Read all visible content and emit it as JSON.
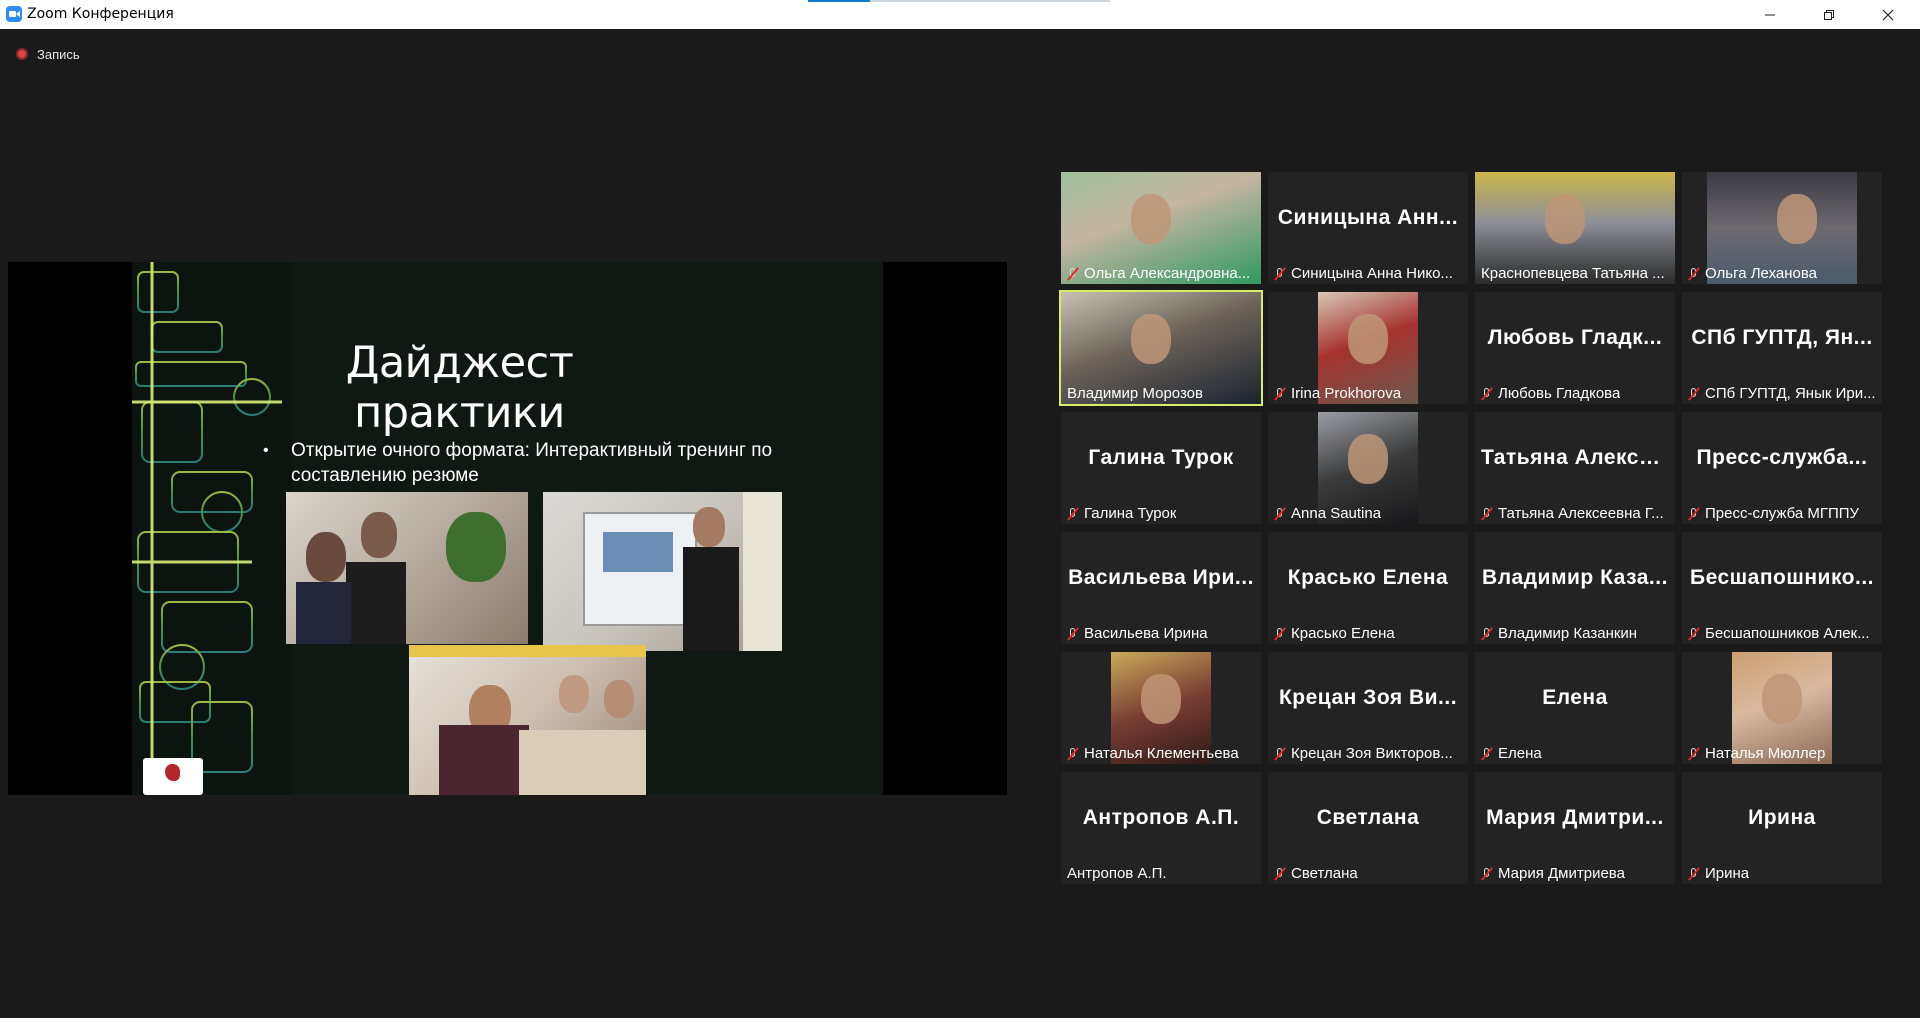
{
  "window": {
    "title": "Zoom Конференция"
  },
  "recording": {
    "label": "Запись"
  },
  "slide": {
    "title": "Дайджест практики",
    "bullet": "Открытие очного формата: Интерактивный тренинг по составлению резюме"
  },
  "participants": [
    {
      "name": "Ольга Александровна...",
      "display": "",
      "has_video": true,
      "muted": true
    },
    {
      "name": "Синицына Анна Нико...",
      "display": "Синицына Анн...",
      "has_video": false,
      "muted": true
    },
    {
      "name": "Краснопевцева Татьяна ...",
      "display": "",
      "has_video": true,
      "muted": false
    },
    {
      "name": "Ольга Леханова",
      "display": "",
      "has_video": true,
      "muted": true
    },
    {
      "name": "Владимир Морозов",
      "display": "",
      "has_video": true,
      "muted": false,
      "active_speaker": true
    },
    {
      "name": "Irina Prokhorova",
      "display": "",
      "has_video": true,
      "muted": true
    },
    {
      "name": "Любовь Гладкова",
      "display": "Любовь Гладк...",
      "has_video": false,
      "muted": true
    },
    {
      "name": "СПб ГУПТД, Янык Ири...",
      "display": "СПб ГУПТД, Ян...",
      "has_video": false,
      "muted": true
    },
    {
      "name": "Галина Турок",
      "display": "Галина Турок",
      "has_video": false,
      "muted": true
    },
    {
      "name": "Anna Sautina",
      "display": "",
      "has_video": true,
      "muted": true
    },
    {
      "name": "Татьяна Алексеевна Г...",
      "display": "Татьяна Алексе...",
      "has_video": false,
      "muted": true
    },
    {
      "name": "Пресс-служба МГППУ",
      "display": "Пресс-служба...",
      "has_video": false,
      "muted": true
    },
    {
      "name": "Васильева Ирина",
      "display": "Васильева Ири...",
      "has_video": false,
      "muted": true
    },
    {
      "name": "Красько Елена",
      "display": "Красько Елена",
      "has_video": false,
      "muted": true
    },
    {
      "name": "Владимир Казанкин",
      "display": "Владимир Каза...",
      "has_video": false,
      "muted": true
    },
    {
      "name": "Бесшапошников Алек...",
      "display": "Бесшапошнико...",
      "has_video": false,
      "muted": true
    },
    {
      "name": "Наталья Клементьева",
      "display": "",
      "has_video": true,
      "muted": true
    },
    {
      "name": "Крецан Зоя Викторов...",
      "display": "Крецан Зоя Ви...",
      "has_video": false,
      "muted": true
    },
    {
      "name": "Елена",
      "display": "Елена",
      "has_video": false,
      "muted": true
    },
    {
      "name": "Наталья Мюллер",
      "display": "",
      "has_video": true,
      "muted": true
    },
    {
      "name": "Антропов А.П.",
      "display": "Антропов А.П.",
      "has_video": false,
      "muted": false
    },
    {
      "name": "Светлана",
      "display": "Светлана",
      "has_video": false,
      "muted": true
    },
    {
      "name": "Мария Дмитриева",
      "display": "Мария Дмитри...",
      "has_video": false,
      "muted": true
    },
    {
      "name": "Ирина",
      "display": "Ирина",
      "has_video": false,
      "muted": true
    }
  ],
  "colors": {
    "background": "#1a1a1a",
    "tile": "#232323",
    "active_speaker_border": "#d6ec6a",
    "mute_red": "#e02828",
    "zoom_blue": "#2d8cff"
  }
}
